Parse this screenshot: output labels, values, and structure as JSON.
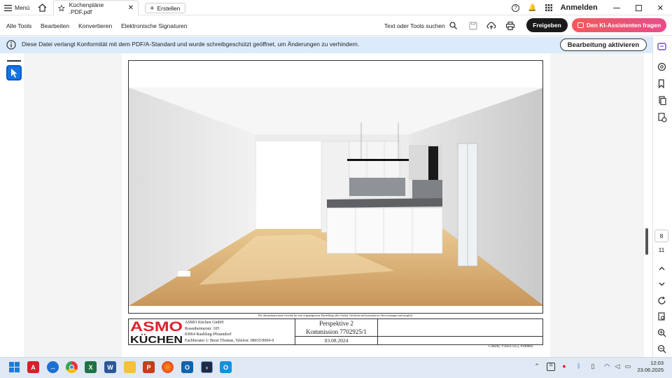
{
  "tabbar": {
    "menu_label": "Menü",
    "doc_tab_title": "Küchenpläne .PDF.pdf",
    "new_tab_label": "Erstellen",
    "sign_in_label": "Anmelden"
  },
  "toolbar": {
    "menus": [
      "Alle Tools",
      "Bearbeiten",
      "Konvertieren",
      "Elektronische Signaturen"
    ],
    "search_label": "Text oder Tools suchen",
    "share_label": "Freigeben",
    "ai_label": "Den KI-Assistenten fragen"
  },
  "banner": {
    "message": "Diese Datei verlangt Konformität mit dem PDF/A-Standard und wurde schreibgeschützt geöffnet, um Änderungen zu verhindern.",
    "enable_edit_label": "Bearbeitung aktivieren"
  },
  "document": {
    "disclaimer": "Wir übernehmen keine Gewähr für eine originalgetreue Darstellung aller Artikel. Farbliche und konstruktive Abweichungen sind möglich.",
    "logo_top": "ASMO",
    "logo_bottom": "KÜCHEN",
    "company": [
      "ASMO Küchen GmbH",
      "Rosenheimerstr. 105",
      "83064 Raubling-Pfraundorf",
      "Fachberater 1: Brest Thomas, Telefon: 08035/9069-0"
    ],
    "view_title": "Perspektive 2",
    "commission": "Kommission 7702925/1",
    "date": "03.08.2024",
    "carat": "CARAT, V2024.3.0.2, #108682"
  },
  "navigation": {
    "current_page": "8",
    "total_pages": "11"
  },
  "taskbar": {
    "time": "12:03",
    "date": "23.06.2025",
    "apps": [
      "windows-start",
      "acrobat",
      "teamviewer",
      "chrome",
      "excel",
      "word",
      "file-explorer",
      "powerpoint",
      "firefox",
      "outlook",
      "terminal",
      "outlook-new"
    ]
  },
  "colors": {
    "accent": "#1473e6",
    "banner": "#dcebfb",
    "logo_red": "#e2202f",
    "ai_button": "#f25a5a"
  }
}
